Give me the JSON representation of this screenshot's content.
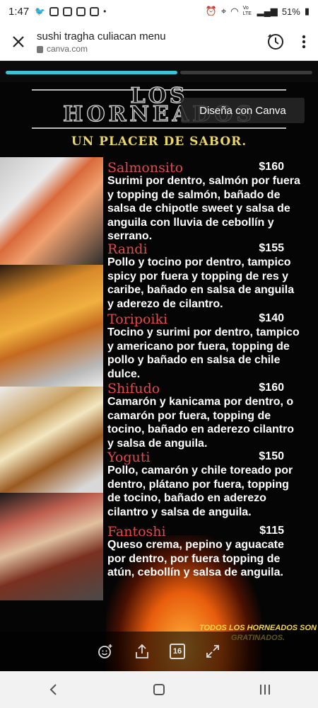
{
  "status": {
    "time": "1:47",
    "battery": "51%",
    "icons": [
      "twitter-icon",
      "instagram-icon",
      "instagram-icon",
      "instagram-icon",
      "snapchat-icon",
      "dot-icon",
      "alarm-icon",
      "location-icon",
      "wifi-icon",
      "volte-icon",
      "signal-icon",
      "battery-icon"
    ],
    "volte": "Vo LTE"
  },
  "browser": {
    "title": "sushi tragha culiacan menu",
    "url": "canva.com"
  },
  "progress": {
    "current_fraction": 0.56
  },
  "flyer": {
    "heading_line1": "LOS",
    "heading_line2": "HORNEADOS",
    "tagline": "UN PLACER DE SABOR.",
    "canva_badge": "Diseña con Canva",
    "footer_note": "TODOS LOS HORNEADOS SON GRATINADOS.",
    "items": [
      {
        "name": "Salmonsito",
        "price": "$160",
        "description": "Surimi por dentro, salmón por fuera y topping de salmón, bañado de salsa de chipotle sweet y salsa de anguila con lluvia de cebollín y serrano."
      },
      {
        "name": "Randi",
        "price": "$155",
        "description": "Pollo y tocino por dentro, tampico spicy por fuera y topping de res y caribe, bañado en salsa de anguila y aderezo de cilantro."
      },
      {
        "name": "Toripoiki",
        "price": "$140",
        "description": "Tocino y surimi por dentro, tampico y americano por fuera, topping de pollo y bañado en salsa de chile dulce."
      },
      {
        "name": "Shifudo",
        "price": "$160",
        "description": "Camarón y kanicama por dentro, o camarón por fuera, topping de tocino, bañado en aderezo cilantro y salsa de anguila."
      },
      {
        "name": "Yoguti",
        "price": "$150",
        "description": "Pollo, camarón y chile toreado por dentro, plátano por fuera, topping de tocino, bañado en aderezo cilantro y salsa de anguila."
      },
      {
        "name": "Fantoshi",
        "price": "$115",
        "description": "Queso crema, pepino y aguacate por dentro, por fuera topping de atún, cebollín y salsa de anguila."
      }
    ]
  },
  "viewer": {
    "page_count": "16"
  }
}
